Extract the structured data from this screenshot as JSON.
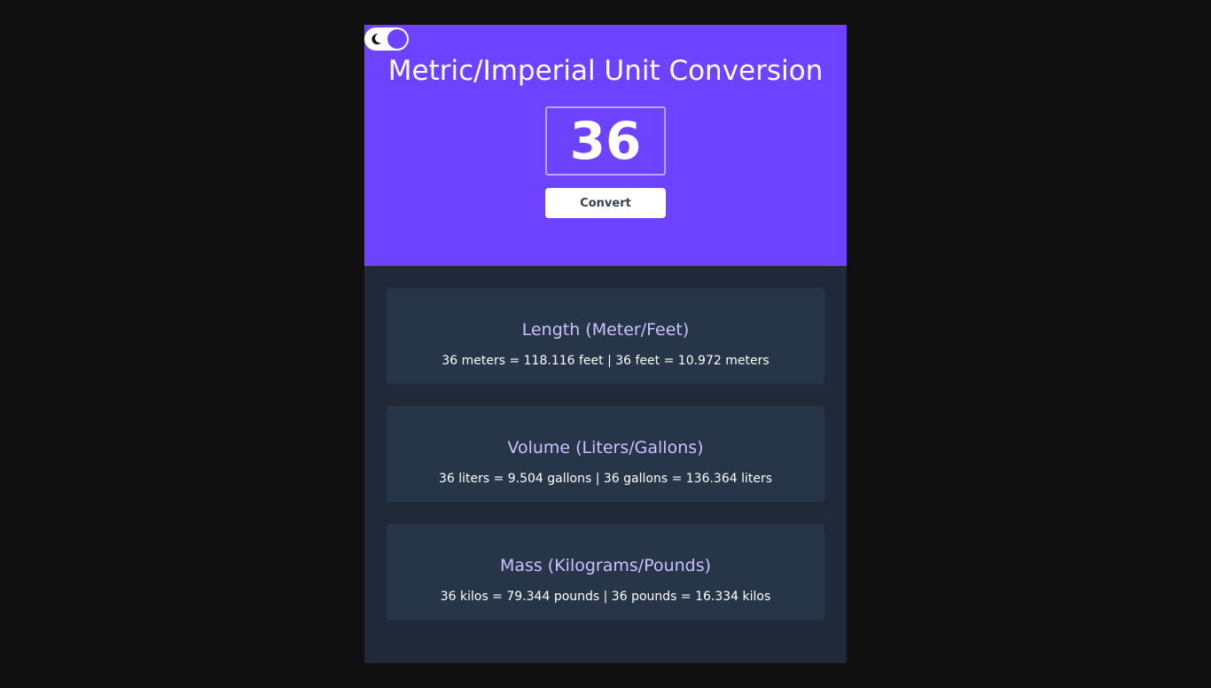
{
  "header": {
    "title": "Metric/Imperial Unit Conversion",
    "input_value": "36",
    "convert_label": "Convert",
    "theme_toggle_icon": "moon-icon"
  },
  "colors": {
    "page_background": "#101010",
    "header_background": "#6d43ff",
    "panel_background": "#1f2937",
    "card_background": "#273549",
    "card_title": "#ccc1ff",
    "card_text": "#ffffff"
  },
  "cards": [
    {
      "title": "Length (Meter/Feet)",
      "text": "36 meters = 118.116 feet | 36 feet = 10.972 meters"
    },
    {
      "title": "Volume (Liters/Gallons)",
      "text": "36 liters = 9.504 gallons | 36 gallons = 136.364 liters"
    },
    {
      "title": "Mass (Kilograms/Pounds)",
      "text": "36 kilos = 79.344 pounds | 36 pounds = 16.334 kilos"
    }
  ]
}
